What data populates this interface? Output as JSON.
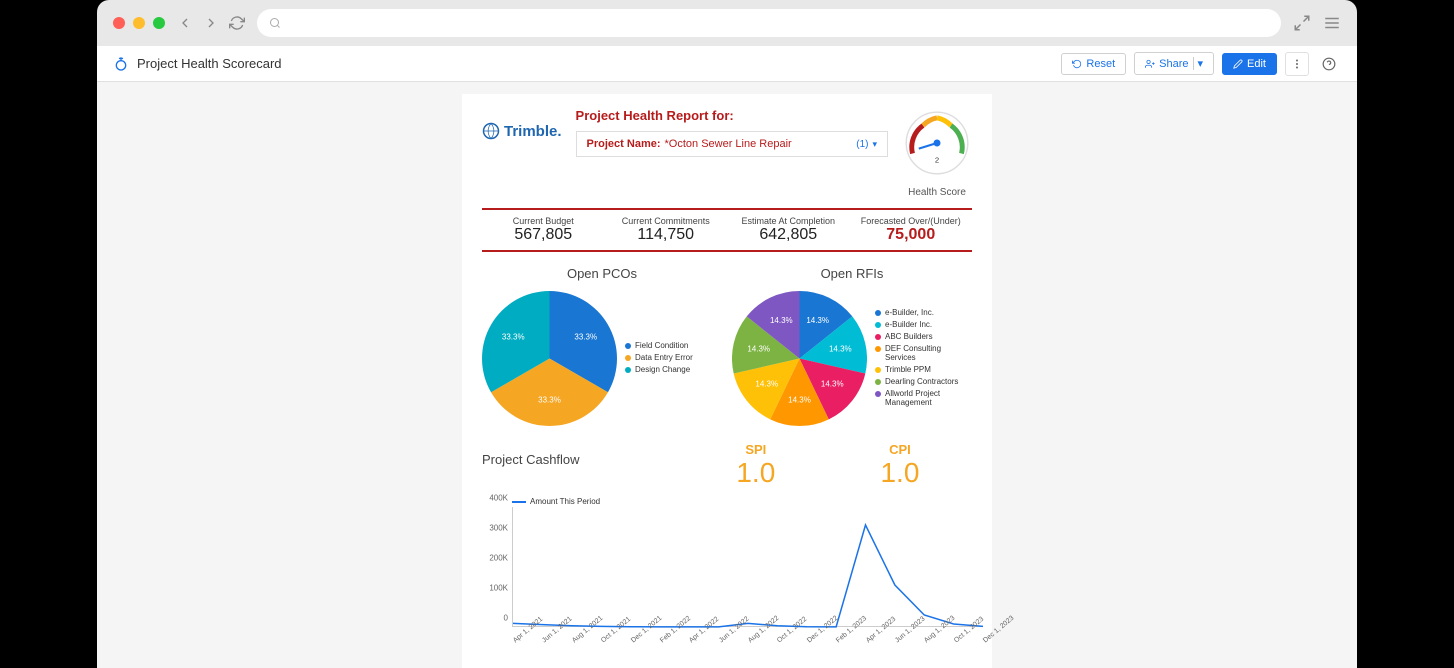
{
  "page_title": "Project Health Scorecard",
  "toolbar": {
    "reset": "Reset",
    "share": "Share",
    "edit": "Edit"
  },
  "report": {
    "brand": "Trimble.",
    "title": "Project Health Report for:",
    "project_label": "Project Name:",
    "project_value": "*Octon Sewer Line Repair",
    "project_count": "(1)",
    "health_score_label": "Health Score",
    "health_score_value": "2"
  },
  "stats": [
    {
      "label": "Current Budget",
      "value": "567,805"
    },
    {
      "label": "Current Commitments",
      "value": "114,750"
    },
    {
      "label": "Estimate At Completion",
      "value": "642,805"
    },
    {
      "label": "Forecasted Over/(Under)",
      "value": "75,000",
      "negative": true
    }
  ],
  "open_pcos_title": "Open PCOs",
  "open_rfis_title": "Open RFIs",
  "cashflow_title": "Project Cashflow",
  "spi": {
    "label": "SPI",
    "value": "1.0"
  },
  "cpi": {
    "label": "CPI",
    "value": "1.0"
  },
  "line_legend": "Amount This Period",
  "chart_data": [
    {
      "type": "pie",
      "title": "Open PCOs",
      "series": [
        {
          "name": "Field Condition",
          "value": 33.3,
          "color": "#1976d2"
        },
        {
          "name": "Data Entry Error",
          "value": 33.3,
          "color": "#f5a623"
        },
        {
          "name": "Design Change",
          "value": 33.3,
          "color": "#00acc1"
        }
      ]
    },
    {
      "type": "pie",
      "title": "Open RFIs",
      "series": [
        {
          "name": "e-Builder, Inc.",
          "value": 14.3,
          "color": "#1976d2"
        },
        {
          "name": "e-Builder Inc.",
          "value": 14.3,
          "color": "#00bcd4"
        },
        {
          "name": "ABC Builders",
          "value": 14.3,
          "color": "#e91e63"
        },
        {
          "name": "DEF Consulting Services",
          "value": 14.3,
          "color": "#ff9800"
        },
        {
          "name": "Trimble PPM",
          "value": 14.3,
          "color": "#ffc107"
        },
        {
          "name": "Dearling Contractors",
          "value": 14.3,
          "color": "#7cb342"
        },
        {
          "name": "Allworld Project Management",
          "value": 14.3,
          "color": "#7e57c2"
        }
      ]
    },
    {
      "type": "line",
      "title": "Project Cashflow",
      "ylabel": "",
      "xlabel": "",
      "ylim": [
        0,
        400000
      ],
      "y_ticks": [
        "0",
        "100K",
        "200K",
        "300K",
        "400K"
      ],
      "x_categories": [
        "Apr 1, 2021",
        "Jun 1, 2021",
        "Aug 1, 2021",
        "Oct 1, 2021",
        "Dec 1, 2021",
        "Feb 1, 2022",
        "Apr 1, 2022",
        "Jun 1, 2022",
        "Aug 1, 2022",
        "Oct 1, 2022",
        "Dec 1, 2022",
        "Feb 1, 2023",
        "Apr 1, 2023",
        "Jun 1, 2023",
        "Aug 1, 2023",
        "Oct 1, 2023",
        "Dec 1, 2023"
      ],
      "series": [
        {
          "name": "Amount This Period",
          "color": "#1a73e8",
          "values": [
            12000,
            8000,
            4000,
            2000,
            1000,
            500,
            500,
            500,
            12000,
            4000,
            1000,
            500,
            340000,
            140000,
            40000,
            10000,
            2000
          ]
        }
      ]
    }
  ]
}
